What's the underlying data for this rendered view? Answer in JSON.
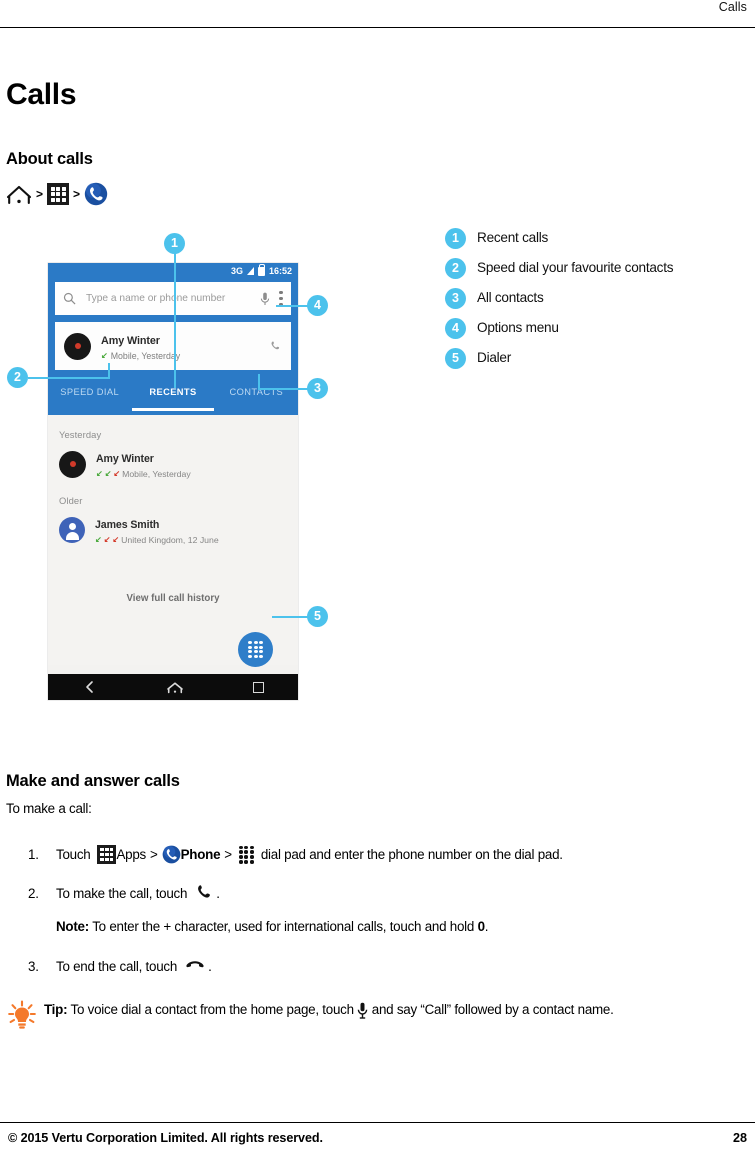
{
  "header": {
    "running_title": "Calls"
  },
  "footer": {
    "copyright": "© 2015 Vertu Corporation Limited. All rights reserved.",
    "page_number": "28"
  },
  "chapter": {
    "title": "Calls"
  },
  "about_section": {
    "heading": "About calls",
    "breadcrumb": {
      "items": [
        {
          "icon": "home-icon"
        },
        {
          "icon": "apps-grid-icon"
        },
        {
          "icon": "phone-icon"
        }
      ],
      "separator": ">"
    }
  },
  "figure": {
    "phone_screenshot": {
      "status_bar": {
        "network": "3G",
        "signal_icon": "signal-bars-icon",
        "lock_icon": "lock-icon",
        "time": "16:52"
      },
      "search": {
        "placeholder": "Type a name or phone number",
        "search_icon": "search-icon",
        "mic_icon": "microphone-icon",
        "menu_icon": "kebab-menu-icon"
      },
      "top_contact": {
        "name": "Amy Winter",
        "detail": "Mobile, Yesterday",
        "call_icon": "call-handset-icon",
        "avatar": "avatar-dark"
      },
      "tabs": [
        {
          "label": "SPEED DIAL",
          "active": false
        },
        {
          "label": "RECENTS",
          "active": true
        },
        {
          "label": "CONTACTS",
          "active": false
        }
      ],
      "groups": [
        {
          "label": "Yesterday",
          "rows": [
            {
              "name": "Amy Winter",
              "detail": "Mobile, Yesterday",
              "arrows": [
                "g",
                "g",
                "r"
              ],
              "avatar": "avatar-dark"
            }
          ]
        },
        {
          "label": "Older",
          "rows": [
            {
              "name": "James Smith",
              "detail": "United Kingdom, 12 June",
              "arrows": [
                "g",
                "r",
                "r"
              ],
              "avatar": "avatar-person-blue"
            }
          ]
        }
      ],
      "view_all": "View full call history",
      "fab_icon": "dialpad-icon",
      "navbar": {
        "back_icon": "back-chevron-icon",
        "home_icon": "home-outline-icon",
        "recents_icon": "square-icon"
      }
    },
    "callouts": [
      {
        "number": "1"
      },
      {
        "number": "2"
      },
      {
        "number": "3"
      },
      {
        "number": "4"
      },
      {
        "number": "5"
      }
    ]
  },
  "legend": {
    "items": [
      {
        "number": "1",
        "label": "Recent calls"
      },
      {
        "number": "2",
        "label": "Speed dial your favourite contacts"
      },
      {
        "number": "3",
        "label": "All contacts"
      },
      {
        "number": "4",
        "label": "Options menu"
      },
      {
        "number": "5",
        "label": "Dialer"
      }
    ]
  },
  "make_section": {
    "heading": "Make and answer calls",
    "intro": "To make a call:",
    "steps": [
      {
        "number": "1.",
        "text_before_icon": "Touch",
        "apps_label": "Apps",
        "sep1": ">",
        "phone_label": "Phone",
        "sep2": ">",
        "text_after": "dial pad and enter the phone number on the dial pad."
      },
      {
        "number": "2.",
        "text": "To make the call, touch",
        "trailing": "."
      },
      {
        "number": "3.",
        "text": "To end the call, touch",
        "trailing": "."
      }
    ],
    "note": {
      "label": "Note:",
      "text_a": "To enter the + character, used for international calls, touch and hold",
      "bold_value": "0",
      "text_b": "."
    }
  },
  "tip": {
    "icon": "lightbulb-tip-icon",
    "label": "Tip:",
    "text": "To voice dial a contact from the home page, touch",
    "text_after": "and say “Call” followed by a contact name."
  },
  "colors": {
    "callout_blue": "#4cc2ec",
    "phone_header_blue": "#2b7ac6",
    "accent_orange": "#f4792b",
    "avatar_blue": "#3f63b8"
  }
}
